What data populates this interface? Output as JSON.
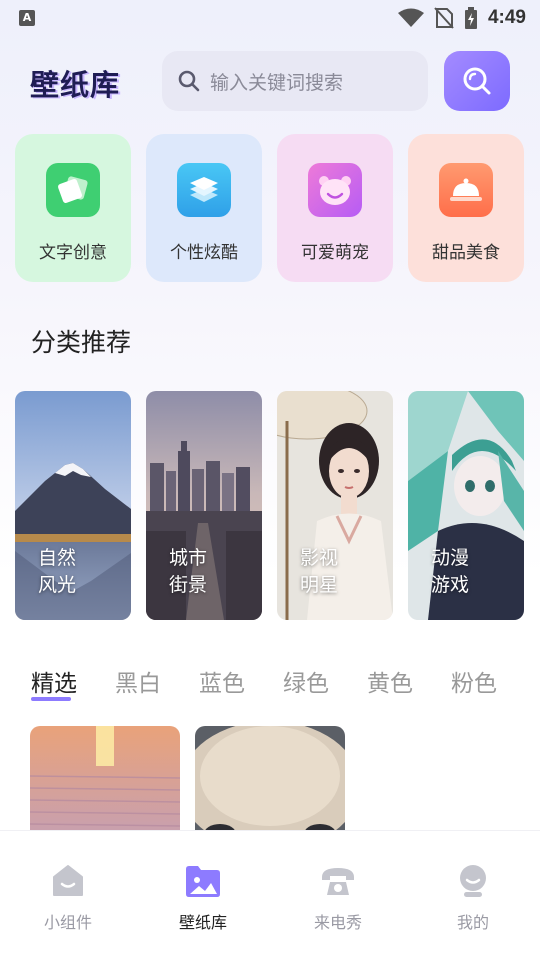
{
  "status_bar": {
    "time": "4:49",
    "notification_badge": "A"
  },
  "header": {
    "logo": "壁纸库",
    "search_placeholder": "输入关键词搜索"
  },
  "quick_categories": [
    {
      "label": "文字创意",
      "icon": "stacked-cards-icon",
      "bg": "#d6f7df",
      "icon_color": "#3fcf72"
    },
    {
      "label": "个性炫酷",
      "icon": "layers-icon",
      "bg": "#dde8fb",
      "icon_color": "#3fb4ee"
    },
    {
      "label": "可爱萌宠",
      "icon": "bear-face-icon",
      "bg": "#f6dcf3",
      "icon_color": "#d36bf2"
    },
    {
      "label": "甜品美食",
      "icon": "food-cloche-icon",
      "bg": "#fde0da",
      "icon_color": "#ff7b56"
    }
  ],
  "section_title": "分类推荐",
  "recommend_categories": [
    {
      "line1": "自然",
      "line2": "风光"
    },
    {
      "line1": "城市",
      "line2": "街景"
    },
    {
      "line1": "影视",
      "line2": "明星"
    },
    {
      "line1": "动漫",
      "line2": "游戏"
    }
  ],
  "tabs": [
    "精选",
    "黑白",
    "蓝色",
    "绿色",
    "黄色",
    "粉色"
  ],
  "active_tab": "精选",
  "bottom_nav": [
    {
      "label": "小组件",
      "icon": "widget-icon"
    },
    {
      "label": "壁纸库",
      "icon": "wallpaper-icon",
      "active": true
    },
    {
      "label": "来电秀",
      "icon": "phone-icon"
    },
    {
      "label": "我的",
      "icon": "profile-icon"
    }
  ],
  "colors": {
    "accent": "#8d7bff",
    "logo": "#1f1d54"
  }
}
